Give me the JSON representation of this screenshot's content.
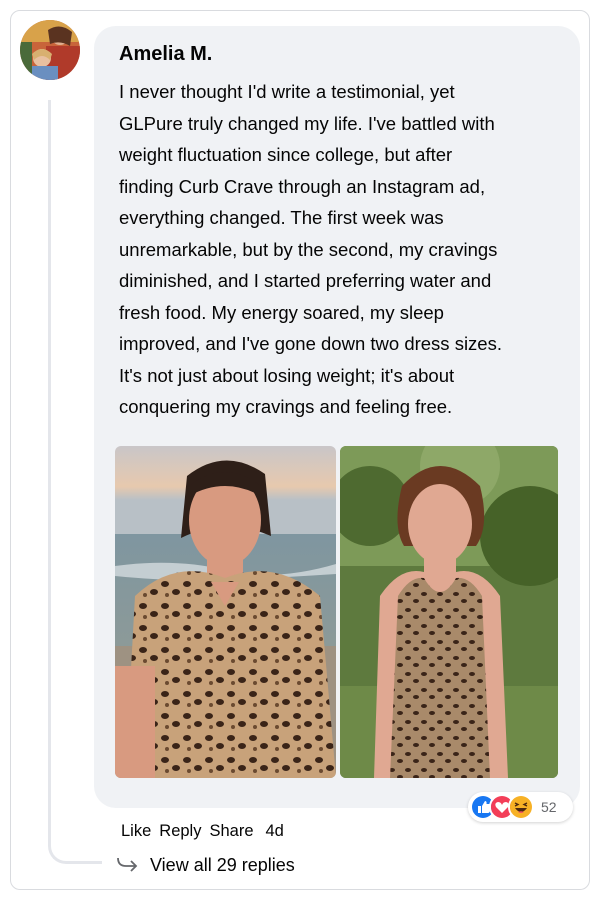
{
  "comment": {
    "author": "Amelia M.",
    "text": "I never thought I'd write a testimonial, yet\nGLPure truly changed my life. I've battled with\nweight fluctuation since college, but after\nfinding Curb Crave through an Instagram ad,\neverything changed. The first week was\nunremarkable, but by the second, my cravings\ndiminished, and I started preferring water and\nfresh food. My energy soared, my sleep\nimproved, and I've gone down two dress sizes.\nIt's not just about losing weight; it's about\nconquering my cravings and feeling free.",
    "photos": [
      "before-photo",
      "after-photo"
    ],
    "reactions": {
      "icons": [
        "like-icon",
        "love-icon",
        "haha-icon"
      ],
      "count": "52"
    },
    "actions": {
      "like": "Like",
      "reply": "Reply",
      "share": "Share",
      "time": "4d"
    },
    "replies_label": "View all 29 replies"
  },
  "colors": {
    "bubble": "#f0f2f5",
    "like_blue": "#1877f2",
    "love_red": "#f33e58",
    "haha_yellow": "#f7b125"
  }
}
